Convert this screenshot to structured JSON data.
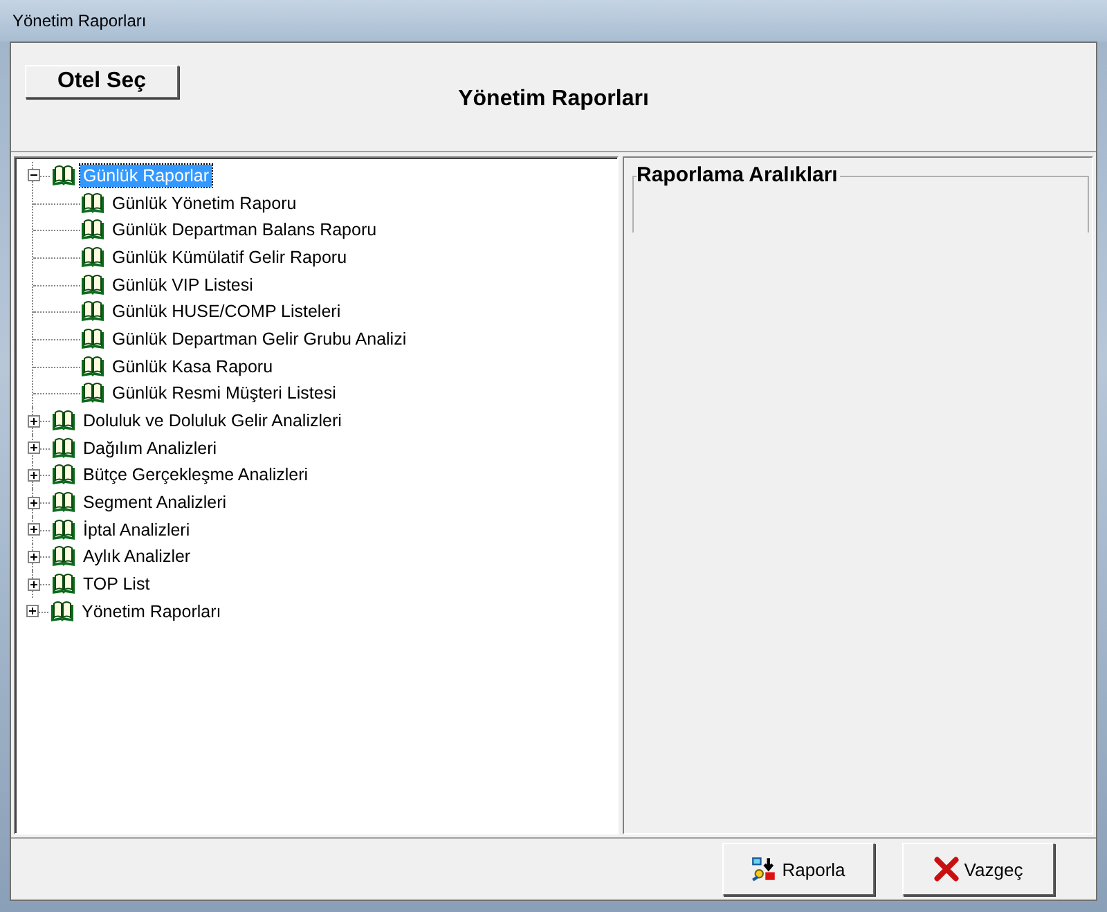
{
  "window": {
    "title": "Yönetim Raporları"
  },
  "hotel_button": {
    "label": "Otel Seç"
  },
  "heading": "Yönetim Raporları",
  "tree": [
    {
      "label": "Günlük Raporlar",
      "selected": true,
      "expanded": true,
      "children": [
        {
          "label": "Günlük Yönetim Raporu",
          "selected": false
        },
        {
          "label": "Günlük Departman Balans Raporu",
          "selected": false
        },
        {
          "label": "Günlük Kümülatif Gelir Raporu",
          "selected": false
        },
        {
          "label": "Günlük VIP Listesi",
          "selected": false
        },
        {
          "label": "Günlük HUSE/COMP Listeleri",
          "selected": false
        },
        {
          "label": "Günlük Departman Gelir Grubu Analizi",
          "selected": false
        },
        {
          "label": "Günlük Kasa Raporu",
          "selected": false
        },
        {
          "label": "Günlük Resmi Müşteri Listesi",
          "selected": false
        }
      ]
    },
    {
      "label": "Doluluk ve Doluluk Gelir Analizleri",
      "selected": false,
      "expanded": false
    },
    {
      "label": "Dağılım Analizleri",
      "selected": false,
      "expanded": false
    },
    {
      "label": "Bütçe Gerçekleşme Analizleri",
      "selected": false,
      "expanded": false
    },
    {
      "label": "Segment Analizleri",
      "selected": false,
      "expanded": false
    },
    {
      "label": "İptal Analizleri",
      "selected": false,
      "expanded": false
    },
    {
      "label": "Aylık Analizler",
      "selected": false,
      "expanded": false
    },
    {
      "label": "TOP List",
      "selected": false,
      "expanded": false
    },
    {
      "label": "Yönetim Raporları",
      "selected": false,
      "expanded": false
    }
  ],
  "group_box": {
    "title": "Raporlama Aralıkları"
  },
  "buttons": [
    {
      "kind": "report",
      "label": "Raporla"
    },
    {
      "kind": "cancel",
      "label": "Vazgeç"
    }
  ]
}
